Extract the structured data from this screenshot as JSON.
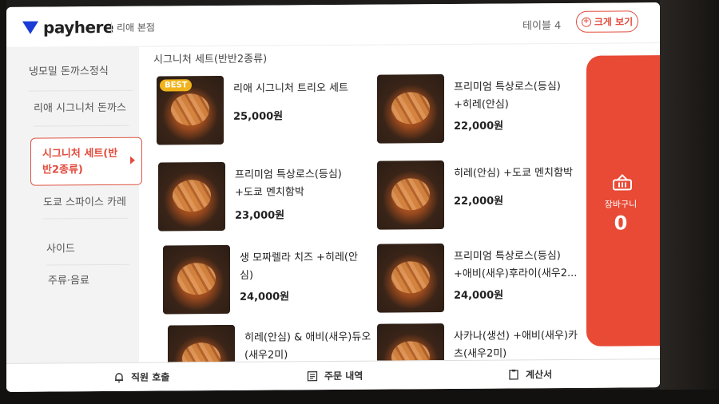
{
  "header": {
    "brand": "payhere",
    "store": "리애 본점",
    "table": "테이블 4",
    "zoom_label": "크게 보기"
  },
  "sidebar": {
    "items": [
      {
        "label": "냉모밀 돈까스정식"
      },
      {
        "label": "리애 시그니처 돈까스"
      },
      {
        "label": "시그니처 세트(반반2종류)",
        "active": true
      },
      {
        "label": "도쿄 스파이스 카레"
      },
      {
        "label": "사이드"
      },
      {
        "label": "주류·음료"
      }
    ]
  },
  "main": {
    "section_title": "시그니처 세트(반반2종류)",
    "best_badge": "BEST",
    "items": [
      {
        "name": "리애 시그니처 트리오 세트",
        "price": "25,000원",
        "best": true
      },
      {
        "name": "프리미엄 특상로스(등심) +히레(안심)",
        "price": "22,000원"
      },
      {
        "name": "프리미엄 특상로스(등심) +도쿄 멘치함박",
        "price": "23,000원"
      },
      {
        "name": "히레(안심) +도쿄 멘치함박",
        "price": "22,000원"
      },
      {
        "name": "생 모짜렐라 치즈 +히레(안심)",
        "price": "24,000원"
      },
      {
        "name": "프리미엄 특상로스(등심) +애비(새우)후라이(새우2...",
        "price": "24,000원"
      },
      {
        "name": "히레(안심) & 애비(새우)듀오 (새우2미)",
        "price": ""
      },
      {
        "name": "사카나(생선) +애비(새우)카츠(새우2미)",
        "price": ""
      }
    ]
  },
  "cart": {
    "label": "장바구니",
    "count": "0",
    "icon": "basket-icon"
  },
  "bottom": {
    "call_staff": "직원 호출",
    "order_history": "주문 내역",
    "bill": "계산서"
  }
}
